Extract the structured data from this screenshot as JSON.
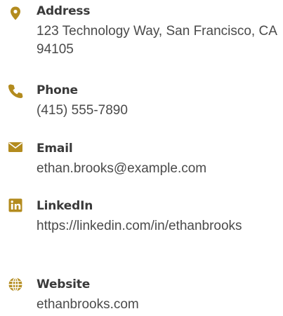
{
  "accent_color": "#b38b1e",
  "contacts": [
    {
      "icon": "map-marker-icon",
      "label": "Address",
      "value": "123 Technology Way, San Francisco, CA 94105"
    },
    {
      "icon": "phone-icon",
      "label": "Phone",
      "value": "(415) 555-7890"
    },
    {
      "icon": "envelope-icon",
      "label": "Email",
      "value": "ethan.brooks@example.com"
    },
    {
      "icon": "linkedin-icon",
      "label": "LinkedIn",
      "value": "https://linkedin.com/in/ethanbrooks"
    },
    {
      "icon": "globe-icon",
      "label": "Website",
      "value": "ethanbrooks.com"
    }
  ]
}
